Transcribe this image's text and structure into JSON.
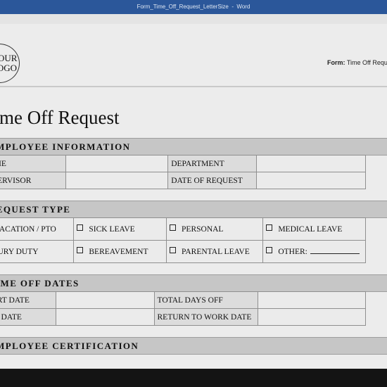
{
  "window": {
    "title": "Form_Time_Off_Request_LetterSize  -  Word"
  },
  "logo": {
    "line1": "YOUR",
    "line2": "LOGO"
  },
  "form_label": {
    "prefix": "Form:",
    "value": "Time Off Request"
  },
  "document": {
    "title": "Time Off Request"
  },
  "sections": {
    "employee_info": "EMPLOYEE INFORMATION",
    "request_type": "REQUEST TYPE",
    "time_off_dates": "TIME OFF DATES",
    "certification": "EMPLOYEE CERTIFICATION"
  },
  "employee_info": {
    "name_label": "NAME",
    "department_label": "DEPARTMENT",
    "supervisor_label": "SUPERVISOR",
    "date_of_request_label": "DATE OF REQUEST"
  },
  "request_type": {
    "vacation": "VACATION / PTO",
    "sick": "SICK LEAVE",
    "personal": "PERSONAL",
    "medical": "MEDICAL LEAVE",
    "jury": "JURY DUTY",
    "bereavement": "BEREAVEMENT",
    "parental": "PARENTAL LEAVE",
    "other": "OTHER:"
  },
  "dates": {
    "start_label": "START DATE",
    "total_days_label": "TOTAL DAYS OFF",
    "end_label": "END DATE",
    "return_label": "RETURN TO WORK DATE"
  }
}
